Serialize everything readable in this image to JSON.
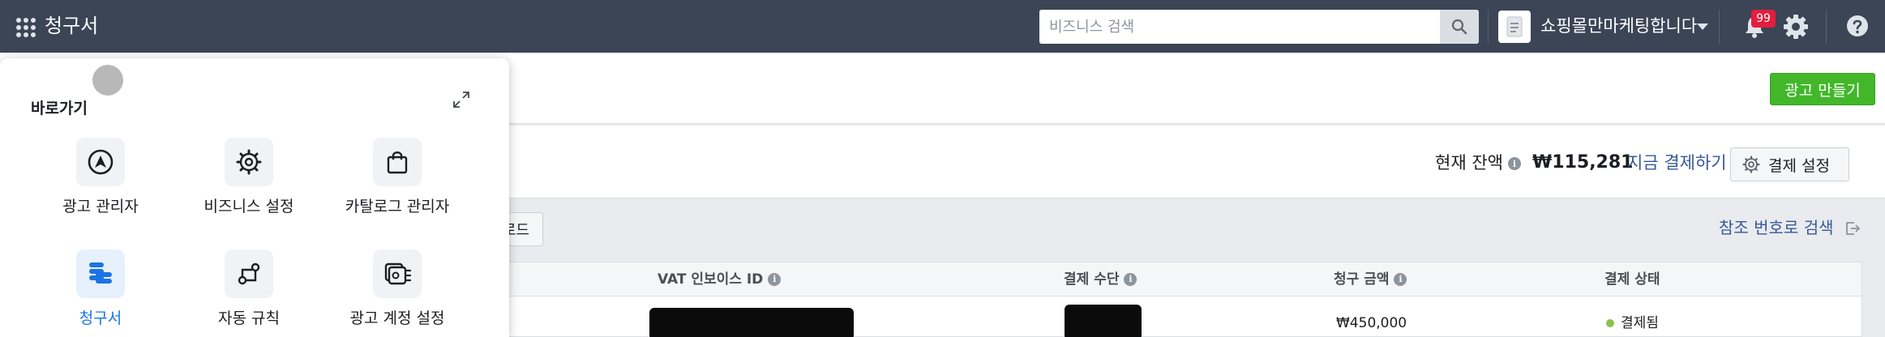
{
  "topbar": {
    "app_title": "청구서",
    "search_placeholder": "비즈니스 검색",
    "business_name": "쇼핑몰만마케팅합니다",
    "notification_count": "99"
  },
  "header": {
    "create_ad_label": "광고 만들기"
  },
  "balance": {
    "label": "현재 잔액",
    "amount": "₩115,281",
    "pay_now_label": "지금 결제하기",
    "payment_settings_label": "결제 설정"
  },
  "toolbar": {
    "download_label": "로드",
    "ref_search_label": "참조 번호로 검색"
  },
  "table": {
    "columns": [
      "VAT 인보이스 ID",
      "결제 수단",
      "청구 금액",
      "결제 상태"
    ],
    "rows": [
      {
        "amount": "₩450,000",
        "status": "결제됨"
      }
    ]
  },
  "shortcuts_panel": {
    "title": "바로가기",
    "items": [
      {
        "label": "광고 관리자",
        "icon": "ads-manager-icon"
      },
      {
        "label": "비즈니스 설정",
        "icon": "gear-icon"
      },
      {
        "label": "카탈로그 관리자",
        "icon": "shopping-bag-icon"
      },
      {
        "label": "청구서",
        "icon": "billing-database-icon",
        "active": true
      },
      {
        "label": "자동 규칙",
        "icon": "automated-rules-icon"
      },
      {
        "label": "광고 계정 설정",
        "icon": "ad-account-settings-icon"
      }
    ]
  },
  "colors": {
    "topbar": "#3b4556",
    "create_button": "#42b72a",
    "link": "#385898",
    "active": "#1b74e4",
    "badge": "#e41e3f",
    "status_paid": "#8bc34a"
  }
}
